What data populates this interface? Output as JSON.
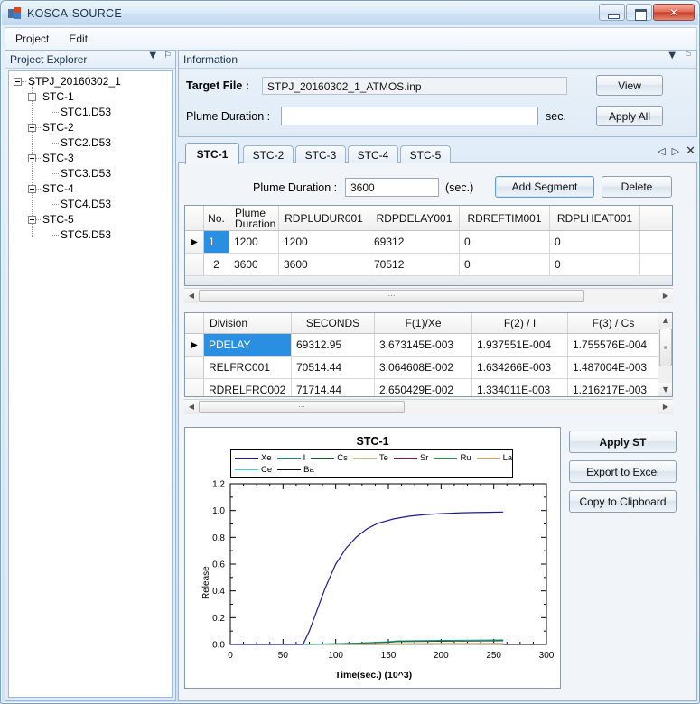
{
  "window": {
    "title": "KOSCA-SOURCE",
    "icon": "app-icon",
    "controls": {
      "minimize": "minimize",
      "maximize": "maximize",
      "close": "✕"
    }
  },
  "menubar": {
    "items": [
      "Project",
      "Edit"
    ]
  },
  "sidebar": {
    "title": "Project Explorer",
    "tools": {
      "dropdown": "▼",
      "pin": "⚐"
    },
    "tree": [
      {
        "label": "STPJ_20160302_1",
        "level": 0,
        "expander": true
      },
      {
        "label": "STC-1",
        "level": 1,
        "expander": true
      },
      {
        "label": "STC1.D53",
        "level": 2,
        "expander": false
      },
      {
        "label": "STC-2",
        "level": 1,
        "expander": true
      },
      {
        "label": "STC2.D53",
        "level": 2,
        "expander": false
      },
      {
        "label": "STC-3",
        "level": 1,
        "expander": true
      },
      {
        "label": "STC3.D53",
        "level": 2,
        "expander": false
      },
      {
        "label": "STC-4",
        "level": 1,
        "expander": true
      },
      {
        "label": "STC4.D53",
        "level": 2,
        "expander": false
      },
      {
        "label": "STC-5",
        "level": 1,
        "expander": true
      },
      {
        "label": "STC5.D53",
        "level": 2,
        "expander": false
      }
    ]
  },
  "information": {
    "title": "Information",
    "tools": {
      "dropdown": "▼",
      "pin": "⚐"
    },
    "target_file_label": "Target File :",
    "target_file_value": "STPJ_20160302_1_ATMOS.inp",
    "plume_duration_label": "Plume Duration :",
    "plume_duration_value": "",
    "plume_duration_placeholder": "",
    "unit_label": "sec.",
    "view_button": "View",
    "apply_all_button": "Apply All"
  },
  "tabs": {
    "items": [
      {
        "label": "STC-1",
        "active": true
      },
      {
        "label": "STC-2",
        "active": false
      },
      {
        "label": "STC-3",
        "active": false
      },
      {
        "label": "STC-4",
        "active": false
      },
      {
        "label": "STC-5",
        "active": false
      }
    ],
    "nav": {
      "prev": "◁",
      "next": "▷",
      "close": "✕"
    }
  },
  "segment_bar": {
    "plume_duration_label": "Plume Duration :",
    "plume_duration_value": "3600",
    "unit_label": "(sec.)",
    "add_segment_button": "Add Segment",
    "delete_button": "Delete"
  },
  "segment_grid": {
    "columns": [
      "",
      "No.",
      "Plume\nDuration",
      "RDPLUDUR001",
      "RDPDELAY001",
      "RDREFTIM001",
      "RDPLHEAT001"
    ],
    "rows": [
      {
        "indicator": "▶",
        "cells": [
          "1",
          "1200",
          "1200",
          "69312",
          "0",
          "0"
        ],
        "selected_cell": 0
      },
      {
        "indicator": "",
        "cells": [
          "2",
          "3600",
          "3600",
          "70512",
          "0",
          "0"
        ],
        "selected_cell": -1
      }
    ],
    "hscroll": {
      "left_arrow": "◀",
      "right_arrow": "▶",
      "thumb_grip": "⋯"
    }
  },
  "release_grid": {
    "columns": [
      "",
      "Division",
      "SECONDS",
      "F(1)/Xe",
      "F(2) / I",
      "F(3) / Cs"
    ],
    "rows": [
      {
        "indicator": "▶",
        "cells": [
          "PDELAY",
          "69312.95",
          "3.673145E-003",
          "1.937551E-004",
          "1.755576E-004"
        ],
        "selected": true
      },
      {
        "indicator": "",
        "cells": [
          "RELFRC001",
          "70514.44",
          "3.064608E-002",
          "1.634266E-003",
          "1.487004E-003"
        ],
        "selected": false
      },
      {
        "indicator": "",
        "cells": [
          "RDRELFRC002",
          "71714.44",
          "2.650429E-002",
          "1.334011E-003",
          "1.216217E-003"
        ],
        "selected": false
      }
    ],
    "vscroll": {
      "up_arrow": "▲",
      "down_arrow": "▼",
      "thumb_grip": "≡"
    },
    "hscroll": {
      "left_arrow": "◀",
      "right_arrow": "▶",
      "thumb_grip": "⋯"
    }
  },
  "actions": {
    "apply_st": "Apply ST",
    "export_excel": "Export to Excel",
    "copy_clipboard": "Copy to Clipboard"
  },
  "chart_data": {
    "type": "line",
    "title": "STC-1",
    "xlabel": "Time(sec.) (10^3)",
    "ylabel": "Release",
    "xlim": [
      0,
      300
    ],
    "ylim": [
      0.0,
      1.2
    ],
    "xticks": [
      0,
      50,
      100,
      150,
      200,
      250,
      300
    ],
    "yticks": [
      "0.0",
      "0.2",
      "0.4",
      "0.6",
      "0.8",
      "1.0",
      "1.2"
    ],
    "grid": false,
    "legend_position": "top-inside",
    "series": [
      {
        "name": "Xe",
        "color": "#1b1b8f",
        "x": [
          0,
          50,
          65,
          69,
          75,
          82,
          90,
          100,
          110,
          120,
          130,
          140,
          155,
          170,
          185,
          200,
          215,
          230,
          245,
          259
        ],
        "y": [
          0.0,
          0.0,
          0.0,
          0.0,
          0.1,
          0.25,
          0.42,
          0.6,
          0.72,
          0.805,
          0.865,
          0.905,
          0.938,
          0.958,
          0.97,
          0.977,
          0.982,
          0.985,
          0.987,
          0.989
        ]
      },
      {
        "name": "I",
        "color": "#138a7a",
        "x": [
          0,
          65,
          90,
          120,
          150,
          158,
          200,
          259
        ],
        "y": [
          0.0,
          0.0,
          0.004,
          0.01,
          0.02,
          0.026,
          0.03,
          0.034
        ]
      },
      {
        "name": "Cs",
        "color": "#0f5f2a",
        "x": [
          0,
          65,
          90,
          120,
          150,
          158,
          200,
          259
        ],
        "y": [
          0.0,
          0.0,
          0.003,
          0.008,
          0.016,
          0.021,
          0.024,
          0.027
        ]
      },
      {
        "name": "Te",
        "color": "#c9b77e",
        "x": [
          0,
          65,
          100,
          150,
          200,
          259
        ],
        "y": [
          0.0,
          0.0,
          0.002,
          0.006,
          0.008,
          0.009
        ]
      },
      {
        "name": "Sr",
        "color": "#8b1b30",
        "x": [
          0,
          65,
          100,
          150,
          200,
          259
        ],
        "y": [
          0.0,
          0.0,
          0.001,
          0.003,
          0.004,
          0.005
        ]
      },
      {
        "name": "Ru",
        "color": "#2f8f55",
        "x": [
          0,
          65,
          100,
          150,
          200,
          259
        ],
        "y": [
          0.0,
          0.0,
          0.001,
          0.002,
          0.003,
          0.004
        ]
      },
      {
        "name": "La",
        "color": "#d79a52",
        "x": [
          0,
          65,
          100,
          150,
          200,
          259
        ],
        "y": [
          0.0,
          0.0,
          0.0005,
          0.001,
          0.0015,
          0.002
        ]
      },
      {
        "name": "Ce",
        "color": "#34d3e8",
        "x": [
          0,
          65,
          100,
          150,
          200,
          259
        ],
        "y": [
          0.0,
          0.0,
          0.0004,
          0.0008,
          0.001,
          0.0013
        ]
      },
      {
        "name": "Ba",
        "color": "#111111",
        "x": [
          0,
          65,
          100,
          150,
          200,
          259
        ],
        "y": [
          0.0,
          0.0,
          0.0003,
          0.0006,
          0.0008,
          0.001
        ]
      }
    ],
    "legend_rows": [
      [
        "Xe",
        "I",
        "Cs",
        "Te",
        "Sr",
        "Ru",
        "La"
      ],
      [
        "Ce",
        "Ba"
      ]
    ]
  }
}
